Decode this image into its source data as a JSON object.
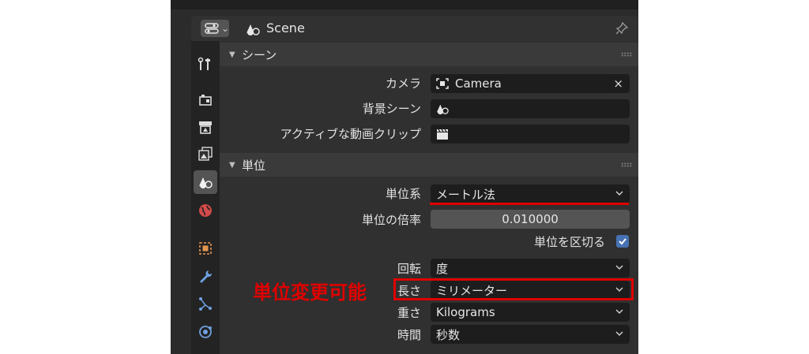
{
  "header": {
    "context_label": "Scene",
    "editor_icon": "properties-editor-icon",
    "context_icon": "scene-icon",
    "pin_icon": "pin-icon"
  },
  "tabs": [
    {
      "icon": "tool-icon"
    },
    {
      "icon": "render-icon"
    },
    {
      "icon": "output-icon"
    },
    {
      "icon": "view-layer-icon"
    },
    {
      "icon": "scene-icon",
      "active": true
    },
    {
      "icon": "world-icon"
    },
    {
      "icon": "object-icon"
    },
    {
      "icon": "modifier-icon"
    },
    {
      "icon": "particles-icon"
    },
    {
      "icon": "physics-icon"
    }
  ],
  "scene_section": {
    "title": "シーン",
    "camera_label": "カメラ",
    "camera_value": "Camera",
    "clear_symbol": "×",
    "background_scene_label": "背景シーン",
    "active_clip_label": "アクティブな動画クリップ"
  },
  "units_section": {
    "title": "単位",
    "unit_system_label": "単位系",
    "unit_system_value": "メートル法",
    "unit_scale_label": "単位の倍率",
    "unit_scale_value": "0.010000",
    "separate_units_label": "単位を区切る",
    "separate_units_checked": true,
    "rotation_label": "回転",
    "rotation_value": "度",
    "length_label": "長さ",
    "length_value": "ミリメーター",
    "mass_label": "重さ",
    "mass_value": "Kilograms",
    "time_label": "時間",
    "time_value": "秒数"
  },
  "annotation": {
    "text": "単位変更可能",
    "color": "#e00000"
  },
  "colors": {
    "panel_bg": "#303030",
    "field_bg": "#1d1d1d",
    "checkbox_accent": "#4772b3"
  }
}
